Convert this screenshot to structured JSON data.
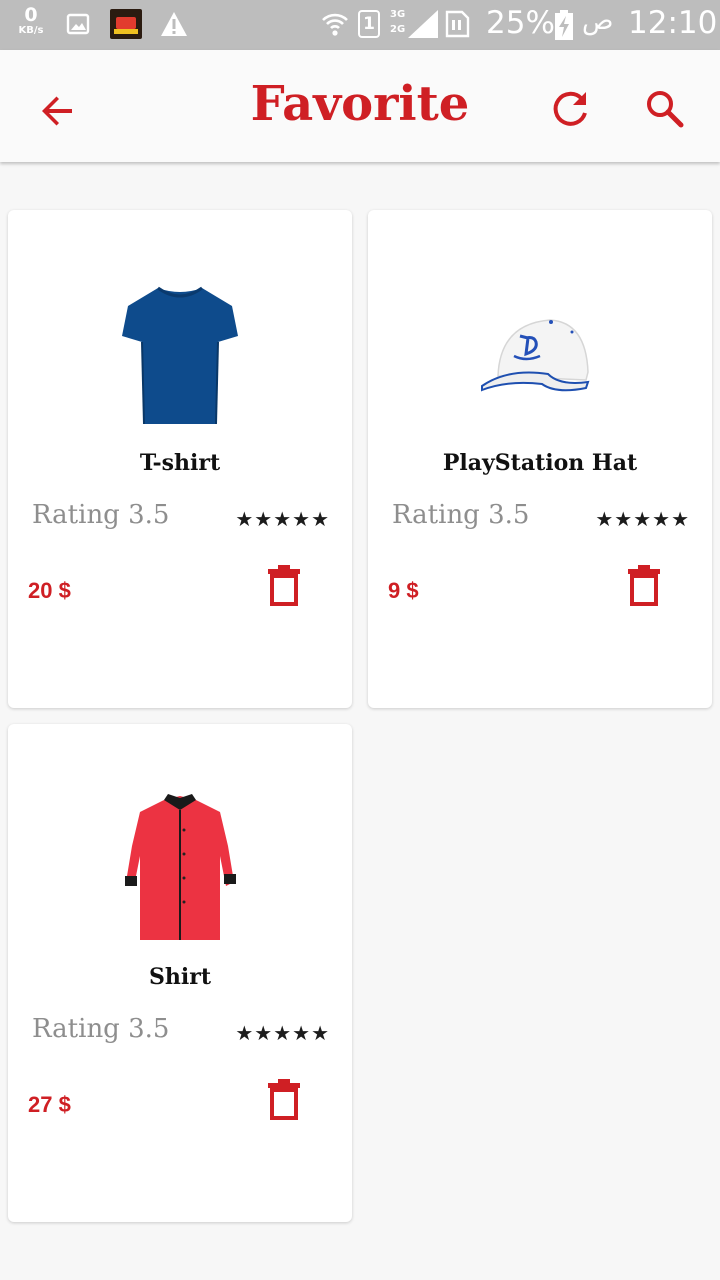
{
  "status_bar": {
    "speed_value": "0",
    "speed_unit": "KB/s",
    "sim_slot": "1",
    "network_top": "3G",
    "network_bottom": "2G",
    "battery_percent": "25%",
    "ampm": "ص",
    "time": "12:10",
    "icons": [
      "image-icon",
      "app-notification-icon",
      "warning-icon",
      "wifi-icon",
      "signal-icon",
      "sim-icon",
      "battery-charging-icon"
    ]
  },
  "app_bar": {
    "title": "Favorite",
    "icons": [
      "back-arrow-icon",
      "refresh-icon",
      "search-icon"
    ]
  },
  "colors": {
    "accent": "#cf1f24",
    "background": "#f7f7f7",
    "card": "#ffffff",
    "rating_text": "#8e8e8e"
  },
  "products": [
    {
      "name": "T-shirt",
      "rating_label": "Rating 3.5",
      "stars": "★★★★★",
      "price": "20 $",
      "image": "blue-tshirt"
    },
    {
      "name": "PlayStation Hat",
      "rating_label": "Rating 3.5",
      "stars": "★★★★★",
      "price": "9 $",
      "image": "white-playstation-cap"
    },
    {
      "name": "Shirt",
      "rating_label": "Rating 3.5",
      "stars": "★★★★★",
      "price": "27 $",
      "image": "red-dress-shirt"
    }
  ]
}
